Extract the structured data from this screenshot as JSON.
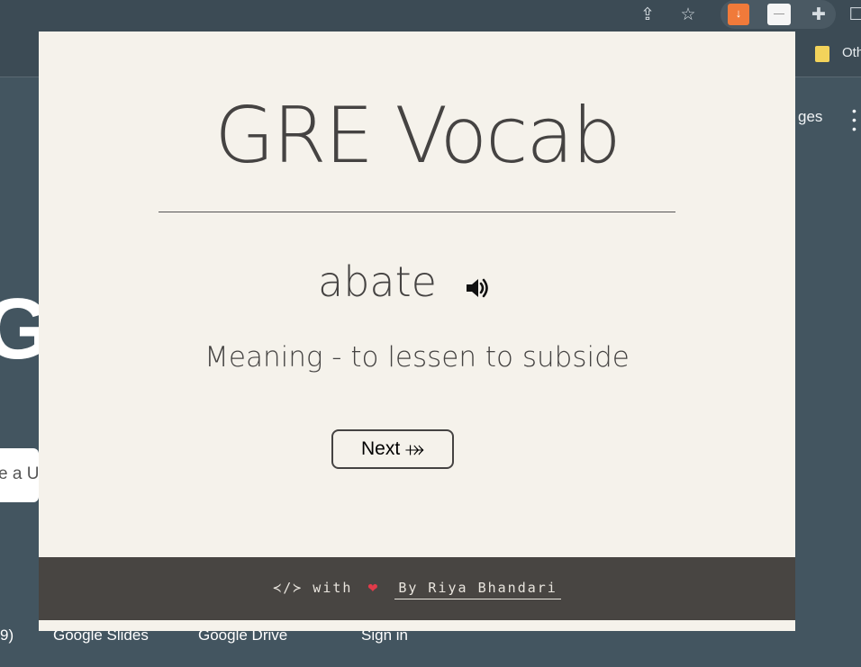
{
  "browser": {
    "toolbar_icons": [
      "share-icon",
      "star-icon",
      "extension-orange-icon",
      "extension-gre-vocab-icon",
      "puzzle-icon",
      "window-icon"
    ],
    "bookmark_label": "Oth",
    "colors": {
      "chrome_bg": "#3c4b55",
      "page_bg": "#435560"
    }
  },
  "background_page": {
    "images_label": "ges",
    "logo_fragment": "G",
    "search_fragment": "e a U",
    "links": [
      "9)",
      "Google Slides",
      "Google Drive",
      "Sign in"
    ]
  },
  "popup": {
    "title": "GRE Vocab",
    "word": "abate",
    "speaker_icon": "speaker-volume-icon",
    "meaning": "Meaning - to lessen to subside",
    "next_label": "Next ⤀",
    "footer": {
      "code_glyph": "≺/≻",
      "with_text": "with",
      "heart_icon": "heart-icon",
      "author": "By Riya Bhandari"
    },
    "colors": {
      "bg": "#f5f2eb",
      "text": "#454342",
      "footer_bg": "#484542"
    }
  }
}
